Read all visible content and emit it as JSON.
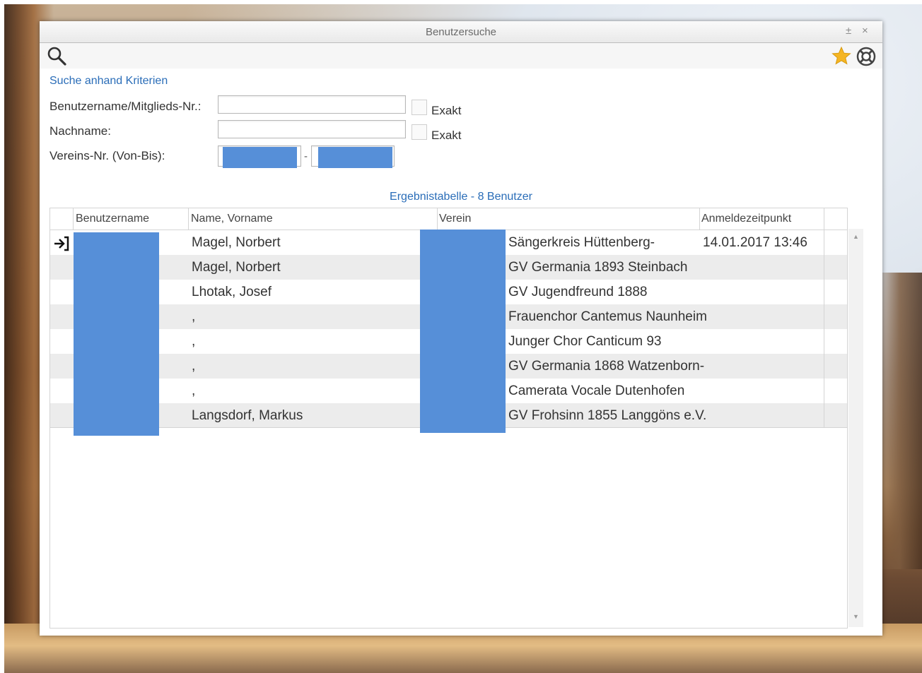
{
  "window": {
    "title": "Benutzersuche",
    "pin_glyph": "±",
    "close_glyph": "×"
  },
  "toolbar": {
    "search_icon": "search-icon",
    "favorite_icon": "star-icon",
    "settings_icon": "lifebuoy-icon",
    "accent_star": "#f5b522"
  },
  "criteria": {
    "title": "Suche anhand Kriterien",
    "username_label": "Benutzername/Mitglieds-Nr.:",
    "lastname_label": "Nachname:",
    "club_range_label": "Vereins-Nr. (Von-Bis):",
    "exact_label": "Exakt",
    "range_separator": "-",
    "username_value": "",
    "lastname_value": ""
  },
  "results": {
    "title": "Ergebnistabelle - 8 Benutzer",
    "columns": [
      "Benutzername",
      "Name, Vorname",
      "Verein",
      "Anmeldezeitpunkt"
    ],
    "rows": [
      {
        "name": "Magel, Norbert",
        "club": "Sängerkreis Hüttenberg-",
        "login": "14.01.2017 13:46"
      },
      {
        "name": "Magel, Norbert",
        "club": "GV Germania 1893 Steinbach",
        "login": ""
      },
      {
        "name": "Lhotak, Josef",
        "club": "GV Jugendfreund 1888",
        "login": ""
      },
      {
        "name": ",",
        "club": "Frauenchor Cantemus Naunheim",
        "login": ""
      },
      {
        "name": ",",
        "club": "Junger Chor Canticum 93",
        "login": ""
      },
      {
        "name": ",",
        "club": "GV Germania 1868 Watzenborn-",
        "login": ""
      },
      {
        "name": ",",
        "club": "Camerata Vocale Dutenhofen",
        "login": ""
      },
      {
        "name": "Langsdorf, Markus",
        "club": "GV Frohsinn 1855 Langgöns e.V.",
        "login": ""
      }
    ],
    "redaction_color": "#568fd8",
    "row_marker_icon": "login-arrow-icon"
  }
}
